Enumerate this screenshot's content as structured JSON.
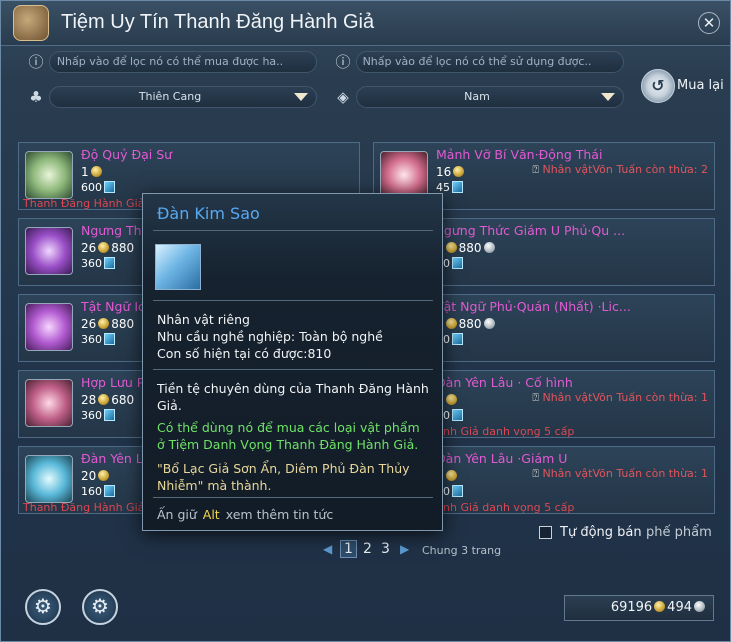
{
  "window": {
    "title": "Tiệm Uy Tín Thanh Đăng Hành Giả"
  },
  "filters": {
    "buyable_placeholder": "Nhấp vào để lọc nó có thể  mua được ha..",
    "usable_placeholder": "Nhấp vào để lọc nó có thể sử dụng được..",
    "category_selected": "Thiên Cang",
    "gender_selected": "Nam",
    "buyback_label": "Mua lại"
  },
  "items": [
    {
      "name": "Độ Quỷ Đại Sư",
      "price_line1": "1",
      "price_line2": "600",
      "condition": "Thanh Đăng Hành Giả"
    },
    {
      "name": "Mảnh Vỡ Bí Văn·Động Thái",
      "price_line1": "16",
      "price_line2": "45",
      "requirement": "Nhân vậtVõn Tuấn còn thừa: 2"
    },
    {
      "name": "Ngưng Th",
      "price_gold": "26",
      "price_silver": "880",
      "price_line2": "360"
    },
    {
      "name": "ngưng Thức Giám U Phủ·Qu ...",
      "price_gold": "6",
      "price_silver": "880",
      "price_line2": "60"
    },
    {
      "name": "Tật Ngữ Ić",
      "price_gold": "26",
      "price_silver": "880",
      "price_line2": "360"
    },
    {
      "name": "Tật Ngữ Phủ·Quán (Nhất) ·Lic...",
      "price_gold": "6",
      "price_silver": "880",
      "price_line2": "60"
    },
    {
      "name": "Hợp Lưu P",
      "price_gold": "28",
      "price_silver": "680",
      "price_line2": "360"
    },
    {
      "name": "Đàn Yên Lâu · Cố hình",
      "price_line1": "0",
      "price_line2": "60",
      "requirement": "Nhân vậtVõn Tuấn còn thừa: 1",
      "condition": "Hành Giả danh vọng 5 cấp"
    },
    {
      "name": "Đàn Yên Lâu",
      "price_line1": "20",
      "price_line2": "160",
      "condition": "Thanh Đăng Hành Giả"
    },
    {
      "name": "Đàn Yên Lâu ·Giám U",
      "price_line1": "0",
      "price_line2": "60",
      "requirement": "Nhân vậtVõn Tuấn còn thừa: 1",
      "condition": "Hành Giả danh vọng 5 cấp"
    }
  ],
  "tooltip": {
    "title": "Đàn Kim Sao",
    "attr1": "Nhân vật riêng",
    "attr2": "Nhu cầu nghề nghiệp: Toàn bộ nghề",
    "attr3": "Con số hiện tại có được:810",
    "desc": "Tiền tệ chuyên dùng của Thanh Đăng Hành Giả.",
    "usage": "Có thể dùng nó để mua các loại vật phẩm ở Tiệm Danh Vọng Thanh Đăng Hành Giả.",
    "quote": "\"Bổ Lạc Giả Sơn Ẩn, Diêm Phủ Đàn Thủy Nhiễm\" mà thành.",
    "hint_before": "Ấn giữ",
    "hint_key": "Alt",
    "hint_after": "xem thêm tin tức"
  },
  "autosell": {
    "label": "Tự động bán",
    "sub": "phế phẩm"
  },
  "pagination": {
    "pages": [
      "1",
      "2",
      "3"
    ],
    "current": "1",
    "total": "Chung 3 trang"
  },
  "currency": {
    "gold": "69196",
    "silver": "494"
  },
  "icons": [
    "logo-icon",
    "close-icon",
    "exclamation-icon",
    "category-icon",
    "diamond-icon",
    "buyback-icon",
    "gold-coin-icon",
    "silver-coin-icon",
    "token-icon",
    "question-icon",
    "gear-icon"
  ]
}
